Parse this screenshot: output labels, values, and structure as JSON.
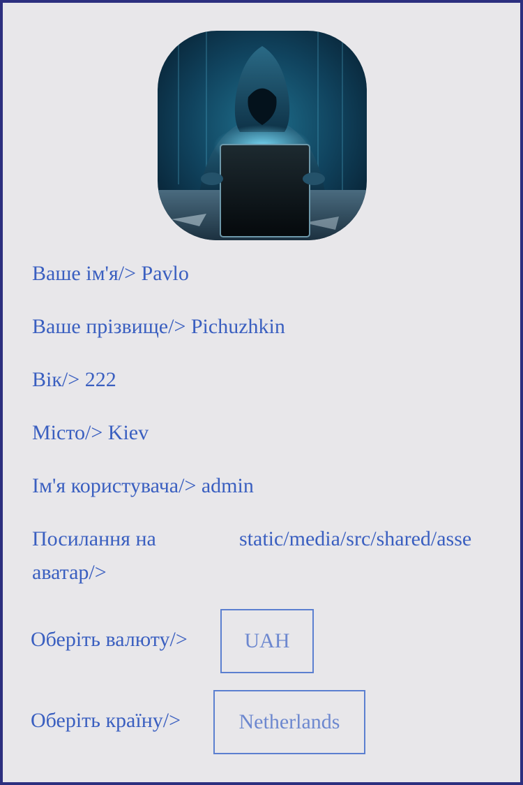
{
  "profile": {
    "first_name": {
      "label": "Ваше ім'я/>",
      "value": "Pavlo"
    },
    "last_name": {
      "label": "Ваше прізвище/>",
      "value": "Pichuzhkin"
    },
    "age": {
      "label": "Вік/>",
      "value": "222"
    },
    "city": {
      "label": "Місто/>",
      "value": "Kiev"
    },
    "username": {
      "label": "Ім'я користувача/>",
      "value": "admin"
    },
    "avatar_link": {
      "label": "Посилання на аватар/>",
      "value": "static/media/src/shared/asse"
    }
  },
  "currency": {
    "label": "Оберіть валюту/>",
    "selected": "UAH"
  },
  "country": {
    "label": "Оберіть країну/>",
    "selected": "Netherlands"
  },
  "colors": {
    "accent": "#3a5fc0",
    "border": "#2c2f7f",
    "background": "#e8e7ea"
  }
}
